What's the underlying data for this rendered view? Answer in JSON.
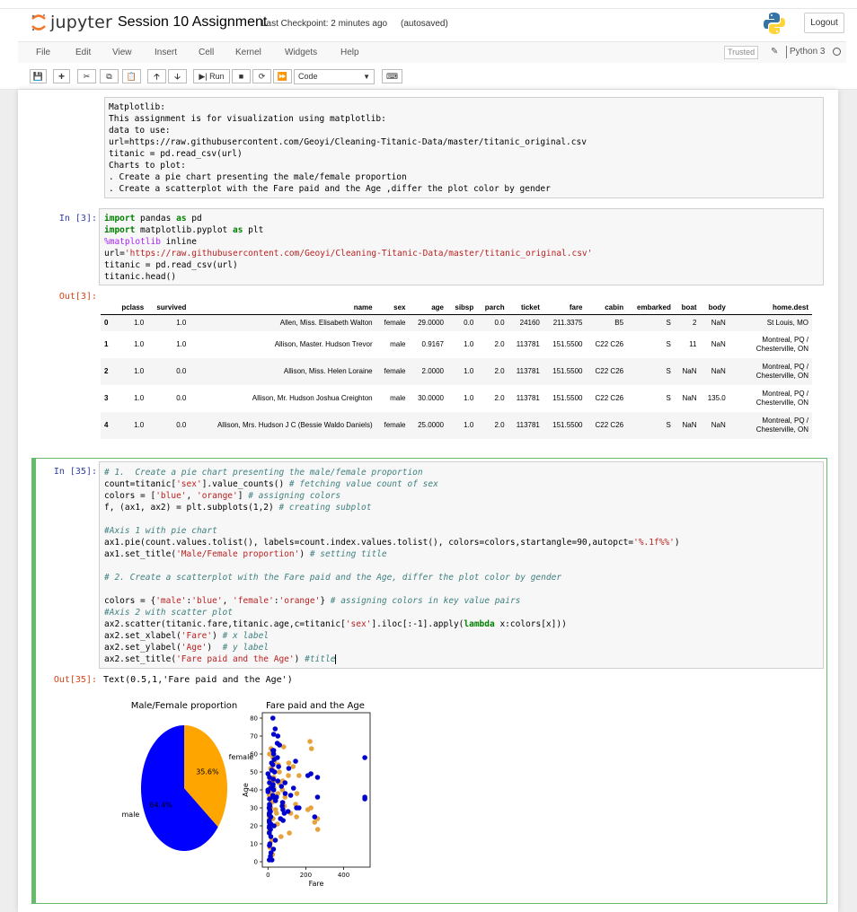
{
  "header": {
    "app_name": "jupyter",
    "notebook_name": "Session 10 Assignment",
    "checkpoint": "Last Checkpoint: 2 minutes ago",
    "autosave": "(autosaved)",
    "logout_label": "Logout"
  },
  "menu": [
    "File",
    "Edit",
    "View",
    "Insert",
    "Cell",
    "Kernel",
    "Widgets",
    "Help"
  ],
  "kernel": {
    "trusted_label": "Trusted",
    "name": "Python 3"
  },
  "toolbar": {
    "run_label": "Run",
    "cell_type": "Code"
  },
  "markdown_cell": {
    "lines": [
      "Matplotlib:",
      "This assignment is for visualization using matplotlib:",
      "data to use:",
      "url=https://raw.githubusercontent.com/Geoyi/Cleaning-Titanic-Data/master/titanic_original.csv",
      "titanic = pd.read_csv(url)",
      "Charts to plot:",
      ". Create a pie chart presenting the male/female proportion",
      ". Create a scatterplot with the Fare paid and the Age ,differ the plot color by gender"
    ]
  },
  "cell3": {
    "in_prompt": "In [3]:",
    "out_prompt": "Out[3]:",
    "code": [
      "import pandas as pd",
      "import matplotlib.pyplot as plt",
      "%matplotlib inline",
      "url='https://raw.githubusercontent.com/Geoyi/Cleaning-Titanic-Data/master/titanic_original.csv'",
      "titanic = pd.read_csv(url)",
      "titanic.head()"
    ],
    "table": {
      "columns": [
        "",
        "pclass",
        "survived",
        "name",
        "sex",
        "age",
        "sibsp",
        "parch",
        "ticket",
        "fare",
        "cabin",
        "embarked",
        "boat",
        "body",
        "home.dest"
      ],
      "rows": [
        [
          "0",
          "1.0",
          "1.0",
          "Allen, Miss. Elisabeth Walton",
          "female",
          "29.0000",
          "0.0",
          "0.0",
          "24160",
          "211.3375",
          "B5",
          "S",
          "2",
          "NaN",
          "St Louis, MO"
        ],
        [
          "1",
          "1.0",
          "1.0",
          "Allison, Master. Hudson Trevor",
          "male",
          "0.9167",
          "1.0",
          "2.0",
          "113781",
          "151.5500",
          "C22 C26",
          "S",
          "11",
          "NaN",
          "Montreal, PQ / Chesterville, ON"
        ],
        [
          "2",
          "1.0",
          "0.0",
          "Allison, Miss. Helen Loraine",
          "female",
          "2.0000",
          "1.0",
          "2.0",
          "113781",
          "151.5500",
          "C22 C26",
          "S",
          "NaN",
          "NaN",
          "Montreal, PQ / Chesterville, ON"
        ],
        [
          "3",
          "1.0",
          "0.0",
          "Allison, Mr. Hudson Joshua Creighton",
          "male",
          "30.0000",
          "1.0",
          "2.0",
          "113781",
          "151.5500",
          "C22 C26",
          "S",
          "NaN",
          "135.0",
          "Montreal, PQ / Chesterville, ON"
        ],
        [
          "4",
          "1.0",
          "0.0",
          "Allison, Mrs. Hudson J C (Bessie Waldo Daniels)",
          "female",
          "25.0000",
          "1.0",
          "2.0",
          "113781",
          "151.5500",
          "C22 C26",
          "S",
          "NaN",
          "NaN",
          "Montreal, PQ / Chesterville, ON"
        ]
      ]
    }
  },
  "cell35": {
    "in_prompt": "In [35]:",
    "out_prompt": "Out[35]:",
    "code": [
      "# 1.  Create a pie chart presenting the male/female proportion",
      "count=titanic['sex'].value_counts() # fetching value count of sex",
      "colors = ['blue', 'orange'] # assigning colors",
      "f, (ax1, ax2) = plt.subplots(1,2) # creating subplot",
      "",
      "#Axis 1 with pie chart",
      "ax1.pie(count.values.tolist(), labels=count.index.values.tolist(), colors=colors,startangle=90,autopct='%.1f%%')",
      "ax1.set_title('Male/Female proportion') # setting title",
      "",
      "# 2. Create a scatterplot with the Fare paid and the Age, differ the plot color by gender",
      "",
      "colors = {'male':'blue', 'female':'orange'} # assigning colors in key value pairs",
      "#Axis 2 with scatter plot",
      "ax2.scatter(titanic.fare,titanic.age,c=titanic['sex'].iloc[:-1].apply(lambda x:colors[x]))",
      "ax2.set_xlabel('Fare') # x label",
      "ax2.set_ylabel('Age')  # y label",
      "ax2.set_title('Fare paid and the Age') #title"
    ],
    "output_text": "Text(0.5,1,'Fare paid and the Age')"
  },
  "chart_data": [
    {
      "type": "pie",
      "title": "Male/Female proportion",
      "labels": [
        "male",
        "female"
      ],
      "values": [
        64.4,
        35.6
      ],
      "autopct_labels": [
        "64.4%",
        "35.6%"
      ],
      "colors": [
        "#0000ff",
        "#ffa500"
      ],
      "startangle": 90
    },
    {
      "type": "scatter",
      "title": "Fare paid and the Age",
      "xlabel": "Fare",
      "ylabel": "Age",
      "xlim": [
        -30,
        540
      ],
      "ylim": [
        -3,
        83
      ],
      "xticks": [
        0,
        200,
        400
      ],
      "yticks": [
        0,
        10,
        20,
        30,
        40,
        50,
        60,
        70,
        80
      ],
      "series": [
        {
          "color": "#e6a23c",
          "points": [
            [
              8,
              22
            ],
            [
              12,
              28
            ],
            [
              26,
              35
            ],
            [
              7,
              19
            ],
            [
              30,
              45
            ],
            [
              15,
              30
            ],
            [
              10,
              26
            ],
            [
              52,
              38
            ],
            [
              76,
              40
            ],
            [
              110,
              55
            ],
            [
              164,
              48
            ],
            [
              27,
              24
            ],
            [
              13,
              18
            ],
            [
              21,
              33
            ],
            [
              40,
              29
            ],
            [
              7,
              25
            ],
            [
              8,
              31
            ],
            [
              15,
              42
            ],
            [
              60,
              50
            ],
            [
              90,
              36
            ],
            [
              120,
              27
            ],
            [
              211,
              29
            ],
            [
              151,
              25
            ],
            [
              262,
              24
            ],
            [
              69,
              14
            ],
            [
              24,
              4
            ],
            [
              13,
              2
            ],
            [
              31,
              41
            ],
            [
              86,
              31
            ],
            [
              55,
              54
            ],
            [
              227,
              30
            ],
            [
              133,
              53
            ],
            [
              78,
              45
            ],
            [
              8,
              60
            ],
            [
              16,
              63
            ],
            [
              153,
              38
            ],
            [
              247,
              22
            ],
            [
              108,
              48
            ],
            [
              83,
              64
            ],
            [
              26,
              58
            ],
            [
              10,
              8
            ],
            [
              20,
              12
            ],
            [
              7,
              37
            ],
            [
              30,
              47
            ],
            [
              50,
              21
            ],
            [
              11,
              45
            ],
            [
              14,
              52
            ],
            [
              35,
              56
            ],
            [
              7,
              17
            ],
            [
              263,
              18
            ],
            [
              230,
              63
            ],
            [
              222,
              67
            ],
            [
              79,
              33
            ],
            [
              57,
              44
            ],
            [
              146,
              32
            ],
            [
              113,
              16
            ],
            [
              9,
              39
            ],
            [
              26,
              51
            ],
            [
              18,
              34
            ],
            [
              45,
              27
            ]
          ]
        },
        {
          "color": "#0000cc",
          "points": [
            [
              7,
              22
            ],
            [
              8,
              35
            ],
            [
              13,
              28
            ],
            [
              26,
              54
            ],
            [
              52,
              45
            ],
            [
              30,
              40
            ],
            [
              7,
              19
            ],
            [
              9,
              29
            ],
            [
              26,
              62
            ],
            [
              77,
              33
            ],
            [
              35,
              50
            ],
            [
              8,
              20
            ],
            [
              15,
              25
            ],
            [
              30,
              71
            ],
            [
              7,
              27
            ],
            [
              10,
              31
            ],
            [
              27,
              43
            ],
            [
              50,
              58
            ],
            [
              91,
              38
            ],
            [
              8,
              47
            ],
            [
              7,
              23
            ],
            [
              13,
              18
            ],
            [
              26,
              36
            ],
            [
              61,
              65
            ],
            [
              0,
              39
            ],
            [
              0,
              40
            ],
            [
              0,
              49
            ],
            [
              7,
              26
            ],
            [
              146,
              56
            ],
            [
              8,
              32
            ],
            [
              30,
              60
            ],
            [
              25,
              42
            ],
            [
              90,
              44
            ],
            [
              15,
              21
            ],
            [
              211,
              48
            ],
            [
              262,
              36
            ],
            [
              151,
              30
            ],
            [
              135,
              41
            ],
            [
              227,
              49
            ],
            [
              110,
              52
            ],
            [
              80,
              23
            ],
            [
              52,
              70
            ],
            [
              26,
              80
            ],
            [
              38,
              74
            ],
            [
              49,
              66
            ],
            [
              512,
              36
            ],
            [
              512,
              58
            ],
            [
              512,
              35
            ],
            [
              30,
              62
            ],
            [
              7,
              16
            ],
            [
              8,
              9
            ],
            [
              13,
              3
            ],
            [
              21,
              1
            ],
            [
              29,
              7
            ],
            [
              39,
              12
            ],
            [
              7,
              1
            ],
            [
              15,
              14
            ],
            [
              6,
              30
            ],
            [
              75,
              31
            ],
            [
              66,
              24
            ],
            [
              28,
              46
            ],
            [
              56,
              53
            ],
            [
              86,
              27
            ],
            [
              26,
              37
            ],
            [
              14,
              41
            ],
            [
              8,
              44
            ],
            [
              19,
              55
            ],
            [
              40,
              34
            ],
            [
              106,
              28
            ],
            [
              120,
              37
            ],
            [
              164,
              30
            ],
            [
              247,
              25
            ],
            [
              262,
              47
            ],
            [
              71,
              42
            ],
            [
              45,
              36
            ],
            [
              20,
              51
            ],
            [
              33,
              57
            ],
            [
              79,
              29
            ],
            [
              10,
              10
            ],
            [
              16,
              5
            ],
            [
              32,
              20
            ]
          ]
        }
      ]
    }
  ]
}
